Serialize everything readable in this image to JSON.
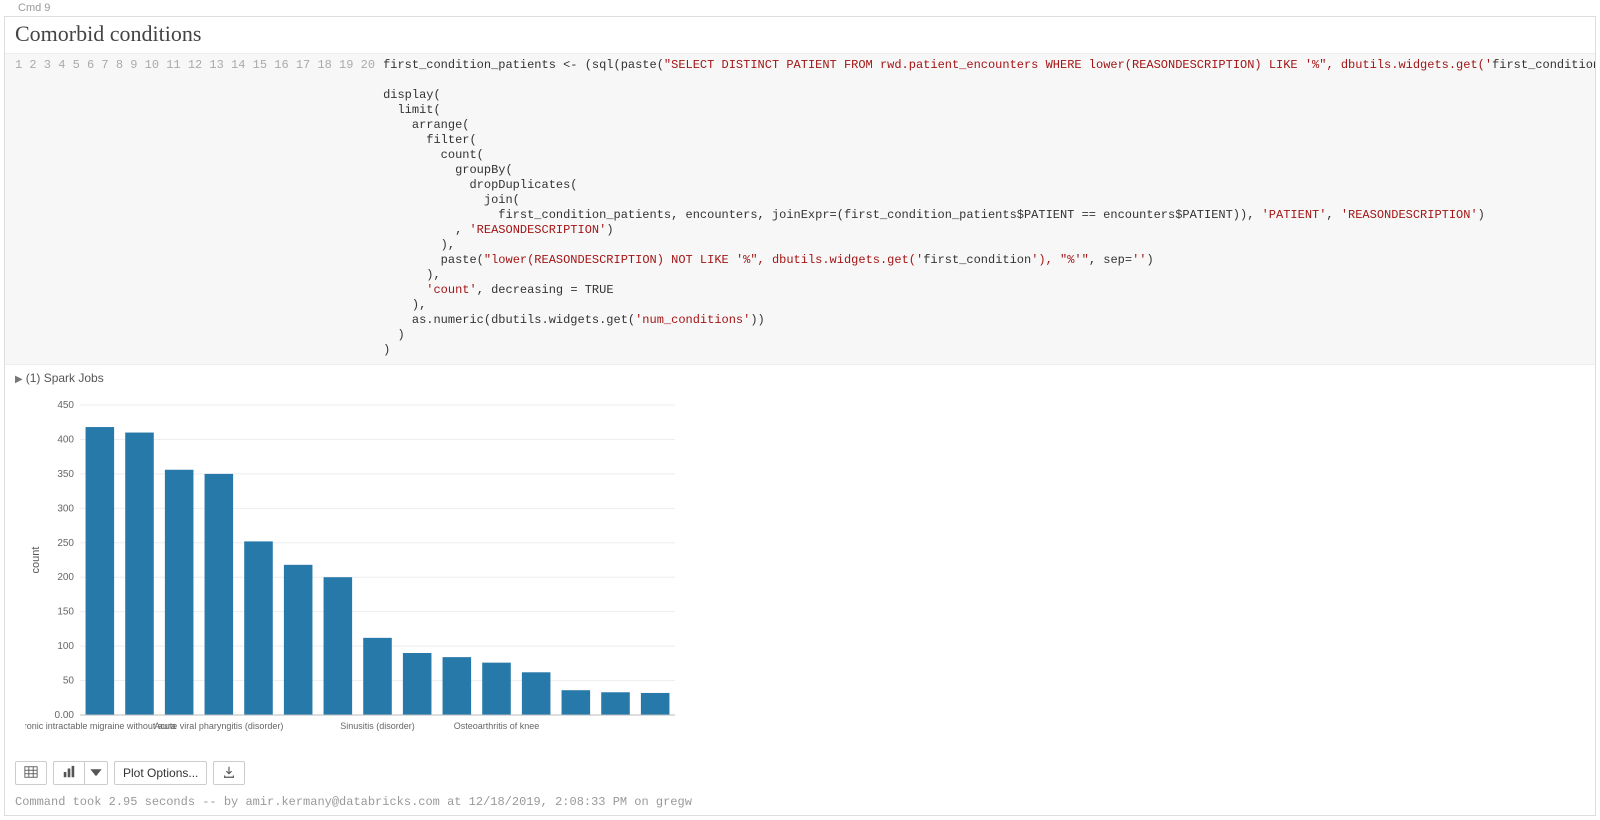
{
  "header": {
    "cmd_label": "Cmd  9",
    "title": "Comorbid conditions"
  },
  "code_lines": [
    "first_condition_patients <- (sql(paste(\"SELECT DISTINCT PATIENT FROM rwd.patient_encounters WHERE lower(REASONDESCRIPTION) LIKE '%\", dbutils.widgets.get('first_condition'), \"%'\", sep = '')))",
    "",
    "display(",
    "  limit(",
    "    arrange(",
    "      filter(",
    "        count(",
    "          groupBy(",
    "            dropDuplicates(",
    "              join(",
    "                first_condition_patients, encounters, joinExpr=(first_condition_patients$PATIENT == encounters$PATIENT)), 'PATIENT', 'REASONDESCRIPTION')",
    "          , 'REASONDESCRIPTION')",
    "        ),",
    "        paste(\"lower(REASONDESCRIPTION) NOT LIKE '%\", dbutils.widgets.get('first_condition'), \"%'\", sep='')",
    "      ),",
    "      'count', decreasing = TRUE",
    "    ),",
    "    as.numeric(dbutils.widgets.get('num_conditions'))",
    "  )",
    ")"
  ],
  "spark_jobs": {
    "label": "(1) Spark Jobs"
  },
  "chart_data": {
    "type": "bar",
    "title": "",
    "xlabel": "",
    "ylabel": "count",
    "ylim": [
      0,
      450
    ],
    "yticks": [
      0.0,
      50,
      100,
      150,
      200,
      250,
      300,
      350,
      400,
      450
    ],
    "ytick_labels": [
      "0.00",
      "50",
      "100",
      "150",
      "200",
      "250",
      "300",
      "350",
      "400",
      "450"
    ],
    "x_visible_labels": [
      {
        "index": 0,
        "label": "ronic intractable migraine without aura"
      },
      {
        "index": 3,
        "label": "Acute viral pharyngitis (disorder)"
      },
      {
        "index": 7,
        "label": "Sinusitis (disorder)"
      },
      {
        "index": 10,
        "label": "Osteoarthritis of knee"
      }
    ],
    "values": [
      418,
      410,
      356,
      350,
      252,
      218,
      200,
      112,
      90,
      84,
      76,
      62,
      36,
      33,
      32
    ]
  },
  "toolbar": {
    "table_button": "Table",
    "chart_button": "Chart",
    "plot_options": "Plot Options...",
    "download_button": "Download"
  },
  "footer": {
    "status": "Command took 2.95 seconds -- by amir.kermany@databricks.com at 12/18/2019, 2:08:33 PM on gregw"
  }
}
